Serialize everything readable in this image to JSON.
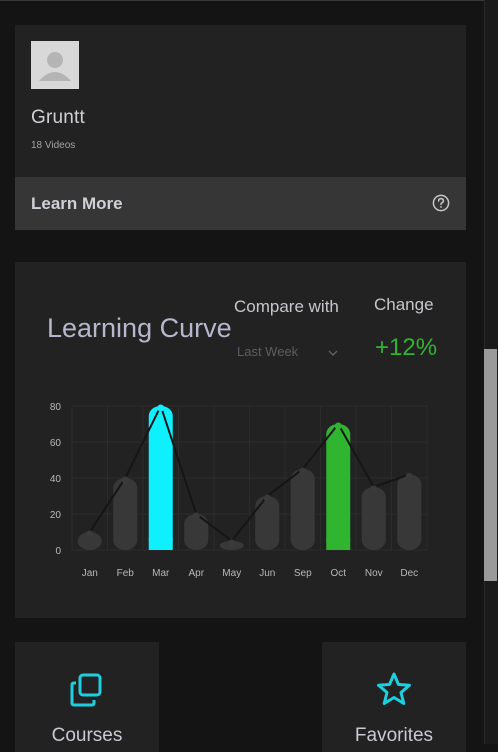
{
  "profile": {
    "name": "Gruntt",
    "videos": "18 Videos",
    "learn_more_label": "Learn More"
  },
  "learning_curve": {
    "title": "Learning Curve",
    "compare_label": "Compare with",
    "compare_value": "Last Week",
    "change_label": "Change",
    "change_value": "+12%"
  },
  "chart_data": {
    "type": "bar",
    "categories": [
      "Jan",
      "Feb",
      "Mar",
      "Apr",
      "May",
      "Jun",
      "Sep",
      "Oct",
      "Nov",
      "Dec"
    ],
    "values": [
      10,
      40,
      80,
      20,
      5,
      30,
      45,
      70,
      35,
      42
    ],
    "highlight": [
      "",
      "",
      "cyan",
      "",
      "",
      "",
      "",
      "green",
      "",
      ""
    ],
    "ylim": [
      0,
      80
    ],
    "yticks": [
      0,
      20,
      40,
      60,
      80
    ],
    "grid": true,
    "colors": {
      "bar": "#383838",
      "cyan": "#0ff0ff",
      "green": "#2fb52f",
      "line": "#151515"
    }
  },
  "tiles": {
    "courses_label": "Courses",
    "favorites_label": "Favorites"
  },
  "icons": {
    "help": "question-circle-icon",
    "chevron": "chevron-down-icon",
    "courses": "copy-icon",
    "favorites": "star-icon"
  }
}
